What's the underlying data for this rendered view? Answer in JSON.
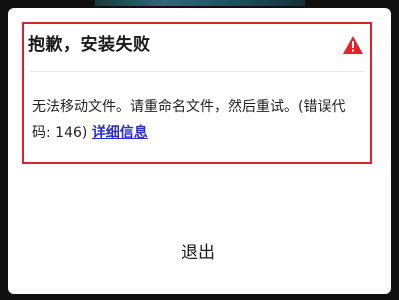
{
  "dialog": {
    "title": "抱歉，安装失败",
    "message_prefix": "无法移动文件。请重命名文件，然后重试。(错误代码: 146)",
    "details_link": "详细信息",
    "exit_label": "退出",
    "icon": "warning-icon"
  },
  "colors": {
    "highlight": "#d8222e",
    "warning": "#e8202a",
    "link": "#2b2bd6"
  }
}
